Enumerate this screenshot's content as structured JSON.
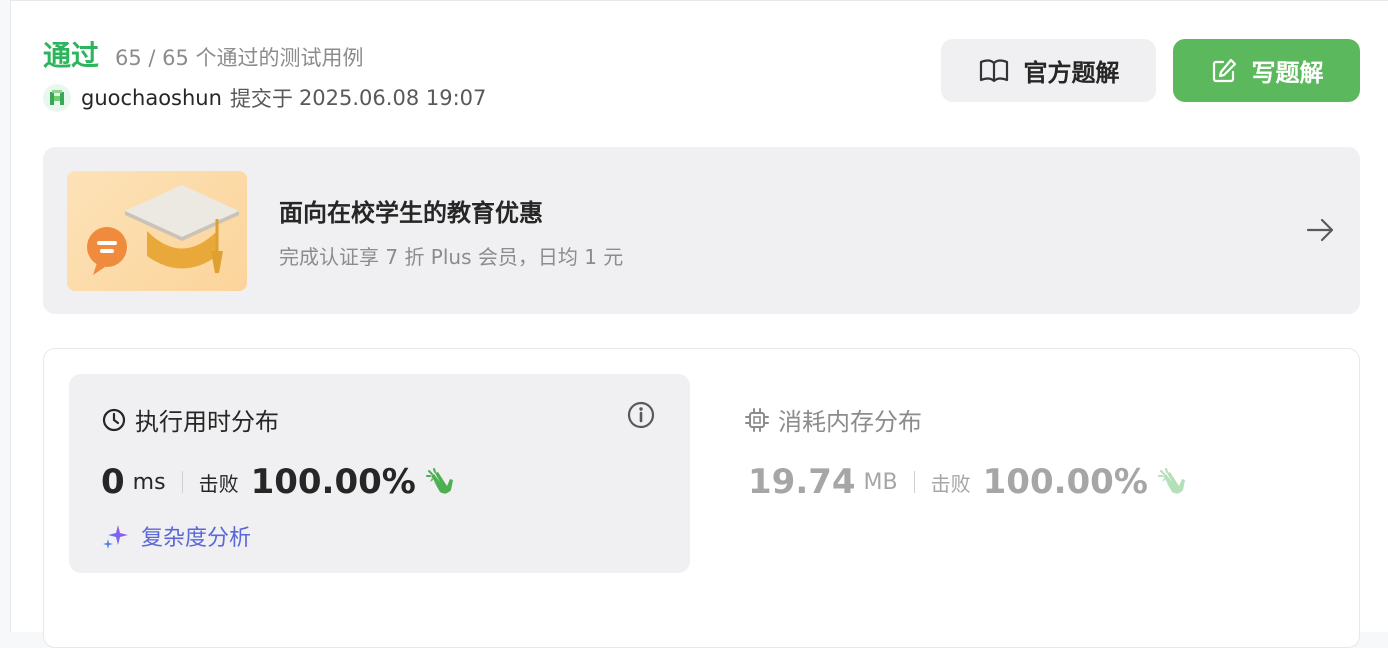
{
  "result": {
    "status": "通过",
    "cases": "65 / 65 个通过的测试用例",
    "user": "guochaoshun",
    "submit_label": "提交于",
    "submit_time": "2025.06.08 19:07"
  },
  "buttons": {
    "official_solution": "官方题解",
    "write_solution": "写题解"
  },
  "promo": {
    "title": "面向在校学生的教育优惠",
    "subtitle": "完成认证享 7 折 Plus 会员，日均 1 元"
  },
  "runtime": {
    "title": "执行用时分布",
    "value": "0",
    "unit": "ms",
    "beat_label": "击败",
    "percent": "100.00%",
    "analyze": "复杂度分析"
  },
  "memory": {
    "title": "消耗内存分布",
    "value": "19.74",
    "unit": "MB",
    "beat_label": "击败",
    "percent": "100.00%"
  },
  "colors": {
    "accent_green": "#2db55d",
    "button_green": "#5cb85c",
    "analyze_purple": "#5a67d8"
  }
}
